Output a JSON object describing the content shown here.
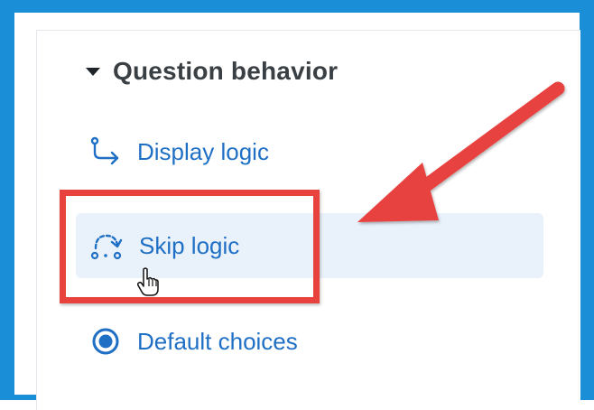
{
  "section": {
    "title": "Question behavior"
  },
  "items": [
    {
      "label": "Display logic",
      "icon": "display-logic-icon"
    },
    {
      "label": "Skip logic",
      "icon": "skip-logic-icon",
      "highlighted": true
    },
    {
      "label": "Default choices",
      "icon": "radio-selected-icon"
    }
  ],
  "colors": {
    "frame": "#1a8ed6",
    "link": "#1f6fc5",
    "highlight_bg": "#e9f1fb",
    "annotation": "#e8423f"
  }
}
